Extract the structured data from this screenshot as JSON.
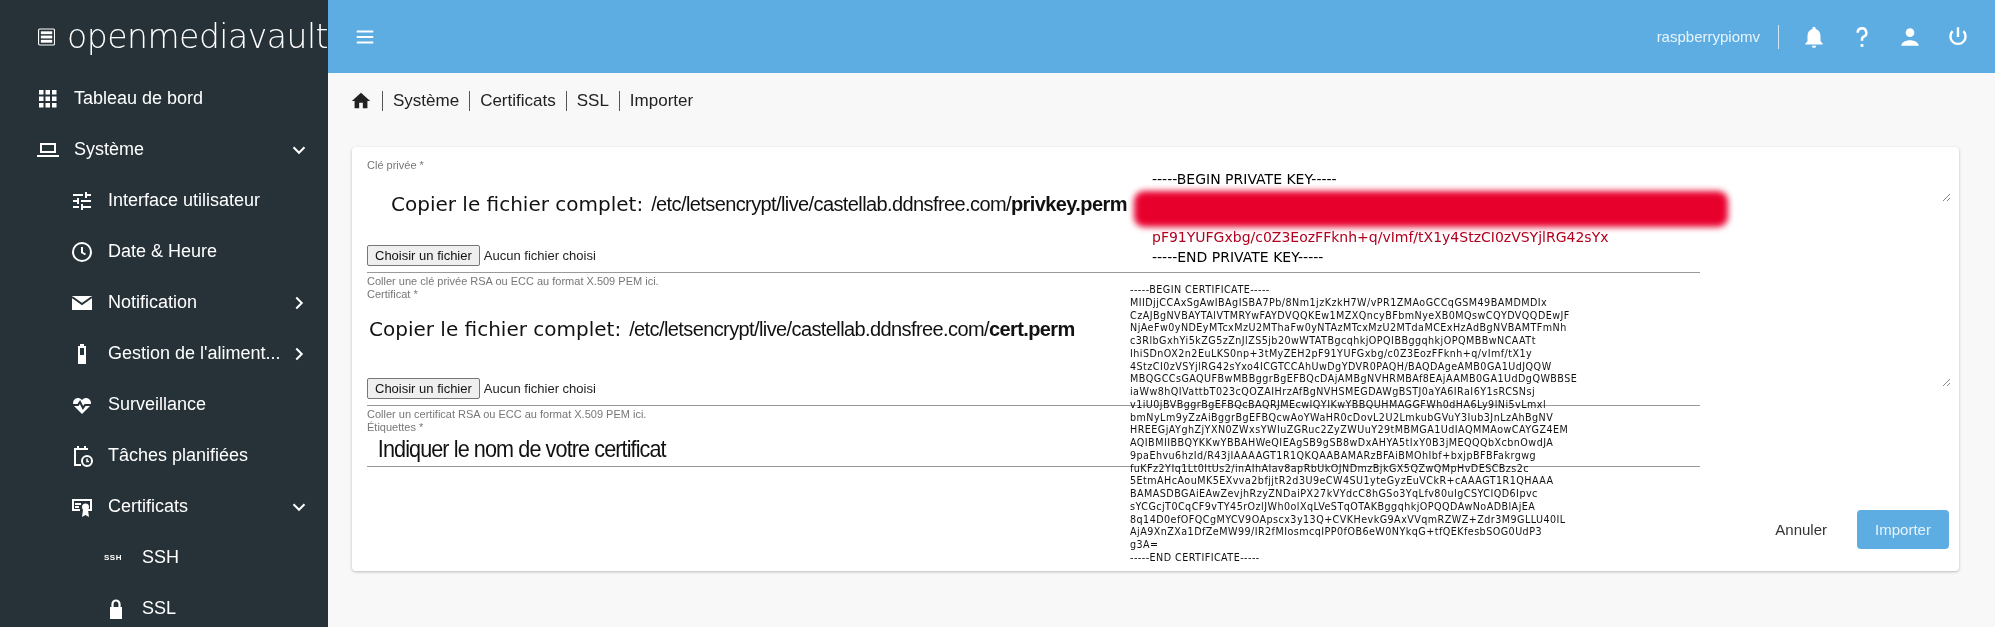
{
  "brand": "openmediavault",
  "sidebar": {
    "items": [
      {
        "label": "Tableau de bord"
      },
      {
        "label": "Système",
        "expanded": true,
        "children": [
          {
            "label": "Interface utilisateur"
          },
          {
            "label": "Date & Heure"
          },
          {
            "label": "Notification",
            "expanded": false
          },
          {
            "label": "Gestion de l'aliment...",
            "expanded": false
          },
          {
            "label": "Surveillance"
          },
          {
            "label": "Tâches planifiées"
          },
          {
            "label": "Certificats",
            "expanded": true,
            "children": [
              {
                "label": "SSH",
                "badge": "SSH"
              },
              {
                "label": "SSL"
              }
            ]
          }
        ]
      }
    ]
  },
  "topbar": {
    "hostname": "raspberrypiomv"
  },
  "breadcrumb": [
    "Système",
    "Certificats",
    "SSL",
    "Importer"
  ],
  "form": {
    "fields": [
      {
        "kind": "file",
        "label": "Clé privée *",
        "note_prefix": "Copier le fichier complet:",
        "note_path": "/etc/letsencrypt/live/castellab.ddnsfree.com/**privkey.perm**",
        "button": "Choisir un fichier",
        "status": "Aucun fichier choisi",
        "hint": "Coller une clé privée RSA ou ECC au format X.509 PEM ici."
      },
      {
        "kind": "file",
        "label": "Certificat *",
        "note_prefix": "Copier le fichier complet:",
        "note_path": "/etc/letsencrypt/live/castellab.ddnsfree.com/**cert.perm**",
        "button": "Choisir un fichier",
        "status": "Aucun fichier choisi",
        "hint": "Coller un certificat RSA ou ECC au format X.509 PEM ici."
      },
      {
        "kind": "text",
        "label": "Étiquettes *",
        "value": "Indiquer le nom de votre certificat"
      }
    ],
    "buttons": [
      {
        "label": "Annuler",
        "kind": "flat"
      },
      {
        "label": "Importer",
        "kind": "primary"
      }
    ]
  },
  "key_text": {
    "lines": [
      "-----BEGIN PRIVATE KEY-----",
      "pF91YUFGxbg/c0Z3EozFFknh+q/vImf/tX1y4StzCI0zVSYjlRG42sYx",
      "-----END PRIVATE KEY-----"
    ]
  },
  "cert_text": {
    "lines": [
      "-----BEGIN CERTIFICATE-----",
      "MIIDjjCCAxSgAwIBAgISBA7Pb/8Nm1jzKzkH7W/vPR1ZMAoGCCqGSM49BAMDMDIx",
      "CzAJBgNVBAYTAlVTMRYwFAYDVQQKEw1MZXQncyBFbmNyeXB0MQswCQYDVQQDEwJF",
      "NjAeFw0yNDEyMTcxMzU2MThaFw0yNTAzMTcxMzU2MTdaMCExHzAdBgNVBAMTFmNh",
      "c3RlbGxhYi5kZG5zZnJlZS5jb20wWTATBgcqhkjOPQIBBggqhkjOPQMBBwNCAATt",
      "IhiSDnOX2n2EuLKS0np+3tMyZEH2pF91YUFGxbg/c0Z3EozFFknh+q/vImf/tX1y",
      "4StzCI0zVSYjlRG42sYxo4ICGTCCAhUwDgYDVR0PAQH/BAQDAgeAMB0GA1UdJQQW",
      "MBQGCCsGAQUFBwMBBggrBgEFBQcDAjAMBgNVHRMBAf8EAjAAMB0GA1UdDgQWBBSE",
      "iaWw8hQIVattbT023cQOZAIHrzAfBgNVHSMEGDAWgBSTJ0aYA6IRaI6Y1sRCSNsj",
      "v1iU0jBVBggrBgEFBQcBAQRJMEcwIQYIKwYBBQUHMAGGFWh0dHA6Ly9lNi5vLmxl",
      "bmNyLm9yZzAiBggrBgEFBQcwAoYWaHR0cDovL2U2LmkubGVuY3Iub3JnLzAhBgNV",
      "HREEGjAYghZjYXN0ZWxsYWIuZGRuc2ZyZWUuY29tMBMGA1UdIAQMMAowCAYGZ4EM",
      "AQIBMIIBBQYKKwYBBAHWeQIEAgSB9gSB8wDxAHYA5tIxY0B3jMEQQQbXcbnOwdJA",
      "9paEhvu6hzId/R43jIAAAAGT1R1QKQAABAMARzBFAiBMOhIbf+bxjpBFBFakrgwg",
      "fuKFz2YIq1Lt0ItUs2/inAIhAIav8apRbUkOJNDmzBjkGX5QZwQMpHvDESCBzs2c",
      "5EtmAHcAouMK5EXvva2bfjjtR2d3U9eCW4SU1yteGyzEuVCkR+cAAAGT1R1QHAAA",
      "BAMASDBGAiEAwZevjhRzyZNDaiPX27kVYdcC8hGSo3YqLfv80uIgCSYCIQD6Ipvc",
      "sYCGcjT0CqCF9vTY45rOzlJWh0olXqLVeSTqOTAKBggqhkjOPQQDAwNoADBlAjEA",
      "8q14D0efOFQCgMYCV9OApscx3y13Q+CVKHevkG9AxVVqmRZWZ+Zdr3M9GLLU40IL",
      "AjA9XnZXa1DfZeMW99/IR2fMIosmcqIPP0fOB6eW0NYkqG+tfQEKfesbSOG0UdP3",
      "g3A=",
      "-----END CERTIFICATE-----"
    ]
  }
}
